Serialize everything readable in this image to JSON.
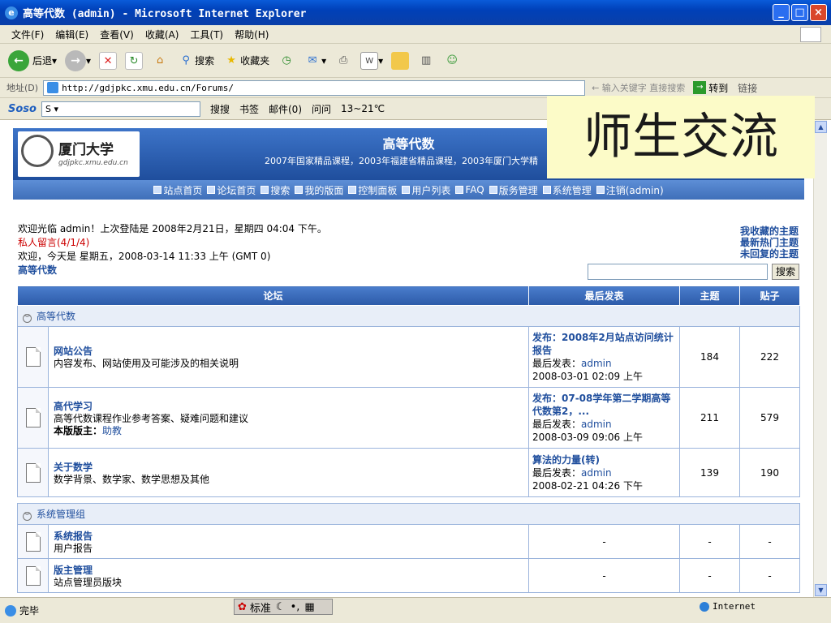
{
  "window": {
    "title": "高等代数 (admin) - Microsoft Internet Explorer"
  },
  "menu": [
    "文件(F)",
    "编辑(E)",
    "查看(V)",
    "收藏(A)",
    "工具(T)",
    "帮助(H)"
  ],
  "toolbar": {
    "back": "后退",
    "search": "搜索",
    "favorites": "收藏夹"
  },
  "address": {
    "label": "地址(D)",
    "url": "http://gdjpkc.xmu.edu.cn/Forums/",
    "hint": "输入关键字 直接搜索",
    "go": "转到",
    "links": "链接"
  },
  "soso": {
    "logo": "Soso",
    "select": "S",
    "items": [
      "搜搜",
      "书签",
      "邮件(0)",
      "问问",
      "13~21℃"
    ]
  },
  "overlay": "师生交流",
  "site": {
    "title": "高等代数",
    "subtitle": "2007年国家精品课程，2003年福建省精品课程，2003年厦门大学精",
    "logo_name": "厦门大学",
    "logo_domain": "gdjpkc.xmu.edu.cn",
    "nav": [
      "站点首页",
      "论坛首页",
      "搜索",
      "我的版面",
      "控制面板",
      "用户列表",
      "FAQ",
      "版务管理",
      "系统管理",
      "注销(admin)"
    ]
  },
  "welcome": {
    "line1": "欢迎光临 admin！上次登陆是 2008年2月21日，星期四 04:04 下午。",
    "pm": "私人留言(4/1/4)",
    "line3": "欢迎，今天是 星期五，2008-03-14 11:33 上午 (GMT 0)",
    "crumb": "高等代数",
    "quick": [
      "我收藏的主题",
      "最新热门主题",
      "未回复的主题"
    ],
    "search_btn": "搜索"
  },
  "table": {
    "headers": [
      "论坛",
      "最后发表",
      "主题",
      "贴子"
    ],
    "groups": [
      {
        "name": "高等代数",
        "forums": [
          {
            "name": "网站公告",
            "desc": "内容发布、网站使用及可能涉及的相关说明",
            "mod_label": "",
            "mod": "",
            "last_title": "发布：2008年2月站点访问统计报告",
            "last_by_label": "最后发表：",
            "last_by": "admin",
            "last_time": "2008-03-01 02:09 上午",
            "topics": "184",
            "posts": "222"
          },
          {
            "name": "高代学习",
            "desc": "高等代数课程作业参考答案、疑难问题和建议",
            "mod_label": "本版版主：",
            "mod": "助教",
            "last_title": "发布：07-08学年第二学期高等代数第2，...",
            "last_by_label": "最后发表：",
            "last_by": "admin",
            "last_time": "2008-03-09 09:06 上午",
            "topics": "211",
            "posts": "579"
          },
          {
            "name": "关于数学",
            "desc": "数学背景、数学家、数学思想及其他",
            "mod_label": "",
            "mod": "",
            "last_title": "算法的力量(转)",
            "last_by_label": "最后发表：",
            "last_by": "admin",
            "last_time": "2008-02-21 04:26 下午",
            "topics": "139",
            "posts": "190"
          }
        ]
      },
      {
        "name": "系统管理组",
        "forums": [
          {
            "name": "系统报告",
            "desc": "用户报告",
            "last": "-",
            "topics": "-",
            "posts": "-"
          },
          {
            "name": "版主管理",
            "desc": "站点管理员版块",
            "last": "-",
            "topics": "-",
            "posts": "-"
          }
        ]
      }
    ]
  },
  "status": {
    "left": "完毕",
    "ime": "标准",
    "zone": "Internet"
  }
}
